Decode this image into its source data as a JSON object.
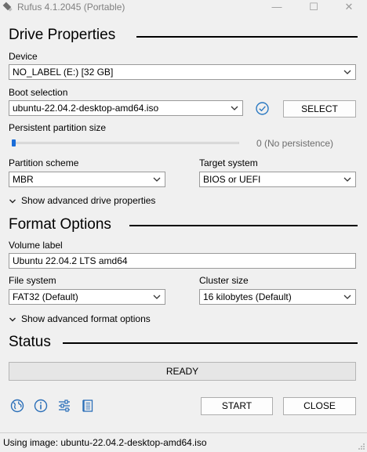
{
  "window": {
    "title": "Rufus 4.1.2045 (Portable)",
    "minimize": "—",
    "maximize": "☐",
    "close": "✕"
  },
  "drive_properties": {
    "heading": "Drive Properties",
    "device_label": "Device",
    "device_value": "NO_LABEL (E:) [32 GB]",
    "boot_label": "Boot selection",
    "boot_value": "ubuntu-22.04.2-desktop-amd64.iso",
    "select_button": "SELECT",
    "persistent_label": "Persistent partition size",
    "persistent_value": "0 (No persistence)",
    "persistent_level": 0,
    "partition_label": "Partition scheme",
    "partition_value": "MBR",
    "target_label": "Target system",
    "target_value": "BIOS or UEFI",
    "advanced_toggle": "Show advanced drive properties"
  },
  "format_options": {
    "heading": "Format Options",
    "volume_label": "Volume label",
    "volume_value": "Ubuntu 22.04.2 LTS amd64",
    "filesystem_label": "File system",
    "filesystem_value": "FAT32 (Default)",
    "cluster_label": "Cluster size",
    "cluster_value": "16 kilobytes (Default)",
    "advanced_toggle": "Show advanced format options"
  },
  "status": {
    "heading": "Status",
    "progress_text": "READY",
    "progress_level": 0
  },
  "actions": {
    "start": "START",
    "close": "CLOSE"
  },
  "toolbar_icons": [
    "language-globe-icon",
    "about-info-icon",
    "settings-sliders-icon",
    "log-icon"
  ],
  "statusbar": {
    "text": "Using image: ubuntu-22.04.2-desktop-amd64.iso"
  },
  "colors": {
    "accent": "#1a6dd8",
    "check": "#2b79c2"
  }
}
